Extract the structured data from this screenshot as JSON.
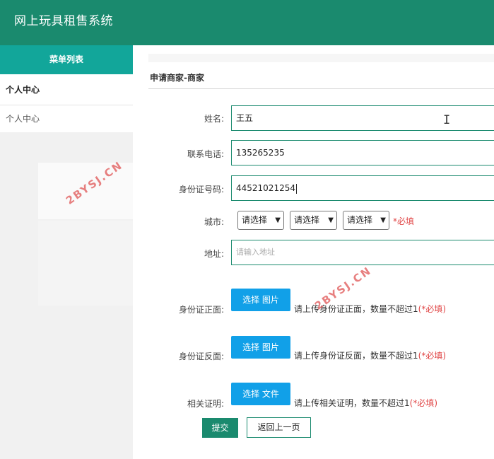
{
  "app": {
    "title": "网上玩具租售系统"
  },
  "sidebar": {
    "header": "菜单列表",
    "group": "个人中心",
    "items": [
      "个人中心"
    ]
  },
  "breadcrumb": "申请商家-商家",
  "form": {
    "name": {
      "label": "姓名:",
      "value": "王五"
    },
    "phone": {
      "label": "联系电话:",
      "value": "135265235"
    },
    "id_number": {
      "label": "身份证号码:",
      "value": "44521021254"
    },
    "city": {
      "label": "城市:",
      "selects": [
        "请选择",
        "请选择",
        "请选择"
      ],
      "required": "*必填"
    },
    "address": {
      "label": "地址:",
      "placeholder": "请输入地址"
    },
    "id_front": {
      "label": "身份证正面:",
      "button": "选择 图片",
      "hint": "请上传身份证正面，数量不超过1",
      "required": "(*必填)"
    },
    "id_back": {
      "label": "身份证反面:",
      "button": "选择 图片",
      "hint": "请上传身份证反面，数量不超过1",
      "required": "(*必填)"
    },
    "proof": {
      "label": "相关证明:",
      "button": "选择 文件",
      "hint": "请上传相关证明，数量不超过1",
      "required": "(*必填)"
    }
  },
  "actions": {
    "submit": "提交",
    "back": "返回上一页"
  },
  "watermark": "2BYSJ.CN",
  "colors": {
    "header": "#1a8a6e",
    "sidebar_header": "#12a69a",
    "upload_button": "#11a0e8",
    "required": "#e04545"
  }
}
